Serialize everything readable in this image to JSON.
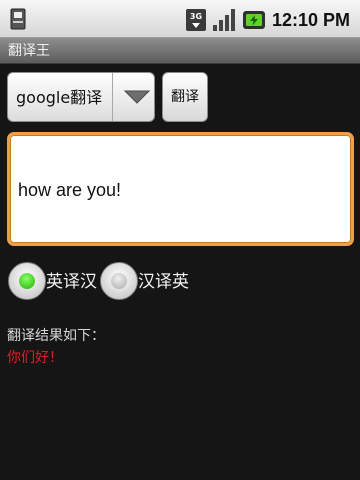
{
  "status_bar": {
    "network_label": "3G",
    "time": "12:10 PM"
  },
  "app": {
    "title": "翻译王"
  },
  "engine_select": {
    "selected": "google翻译"
  },
  "translate_button": {
    "label": "翻译"
  },
  "input": {
    "value": "how are you!"
  },
  "direction": {
    "options": [
      {
        "label": "英译汉",
        "checked": true
      },
      {
        "label": "汉译英",
        "checked": false
      }
    ]
  },
  "result": {
    "caption": "翻译结果如下：",
    "text": "你们好！"
  },
  "colors": {
    "input_focus_border": "#f0a043",
    "radio_checked": "#1fb000",
    "result_text": "#e02020"
  }
}
